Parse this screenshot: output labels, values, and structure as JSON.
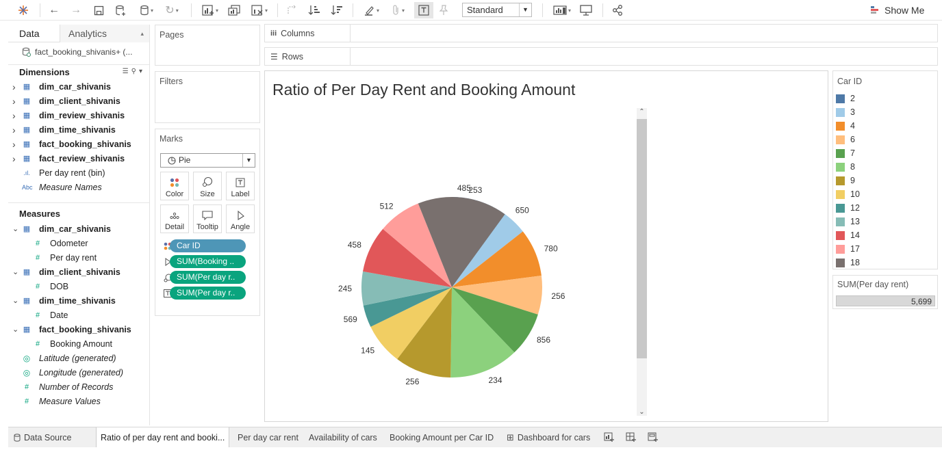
{
  "toolbar": {
    "fit": "Standard",
    "show_me": "Show Me"
  },
  "left_pane": {
    "tabs": [
      "Data",
      "Analytics"
    ],
    "datasource": "fact_booking_shivanis+ (...",
    "dimensions_title": "Dimensions",
    "dimensions": [
      {
        "label": "dim_car_shivanis",
        "kind": "table"
      },
      {
        "label": "dim_client_shivanis",
        "kind": "table"
      },
      {
        "label": "dim_review_shivanis",
        "kind": "table"
      },
      {
        "label": "dim_time_shivanis",
        "kind": "table"
      },
      {
        "label": "fact_booking_shivanis",
        "kind": "table"
      },
      {
        "label": "fact_review_shivanis",
        "kind": "table"
      },
      {
        "label": "Per day rent (bin)",
        "kind": "bin"
      },
      {
        "label": "Measure Names",
        "kind": "abc"
      }
    ],
    "measures_title": "Measures",
    "measures": [
      {
        "label": "dim_car_shivanis",
        "kind": "table-open"
      },
      {
        "label": "Odometer",
        "kind": "num"
      },
      {
        "label": "Per day rent",
        "kind": "num"
      },
      {
        "label": "dim_client_shivanis",
        "kind": "table-open"
      },
      {
        "label": "DOB",
        "kind": "num"
      },
      {
        "label": "dim_time_shivanis",
        "kind": "table-open"
      },
      {
        "label": "Date",
        "kind": "num"
      },
      {
        "label": "fact_booking_shivanis",
        "kind": "table-open"
      },
      {
        "label": "Booking Amount",
        "kind": "num"
      },
      {
        "label": "Latitude (generated)",
        "kind": "globe"
      },
      {
        "label": "Longitude (generated)",
        "kind": "globe"
      },
      {
        "label": "Number of Records",
        "kind": "numi"
      },
      {
        "label": "Measure Values",
        "kind": "numi"
      }
    ]
  },
  "cards": {
    "pages": "Pages",
    "filters": "Filters",
    "marks": "Marks",
    "mark_type": "Pie",
    "mark_buttons": [
      "Color",
      "Size",
      "Label",
      "Detail",
      "Tooltip",
      "Angle"
    ],
    "pills": [
      "Car ID",
      "SUM(Booking ..",
      "SUM(Per day r..",
      "SUM(Per day r.."
    ]
  },
  "shelves": {
    "columns": "Columns",
    "rows": "Rows"
  },
  "view": {
    "title": "Ratio of Per Day Rent and Booking Amount"
  },
  "legend": {
    "title": "Car ID",
    "items": [
      {
        "label": "2",
        "color": "#4e79a7"
      },
      {
        "label": "3",
        "color": "#a0cbe8"
      },
      {
        "label": "4",
        "color": "#f28e2b"
      },
      {
        "label": "6",
        "color": "#ffbe7d"
      },
      {
        "label": "7",
        "color": "#59a14f"
      },
      {
        "label": "8",
        "color": "#8cd17d"
      },
      {
        "label": "9",
        "color": "#b6992d"
      },
      {
        "label": "10",
        "color": "#f1ce63"
      },
      {
        "label": "12",
        "color": "#499894"
      },
      {
        "label": "13",
        "color": "#86bcb6"
      },
      {
        "label": "14",
        "color": "#e15759"
      },
      {
        "label": "17",
        "color": "#ff9d9a"
      },
      {
        "label": "18",
        "color": "#79706e"
      }
    ]
  },
  "size_legend": {
    "title": "SUM(Per day rent)",
    "value": "5,699"
  },
  "chart_data": {
    "type": "pie",
    "categories": [
      "2",
      "3",
      "4",
      "6",
      "7",
      "8",
      "9",
      "10",
      "12",
      "13",
      "14",
      "17",
      "18"
    ],
    "angle_field": "SUM(Booking Amount)",
    "label_field": "SUM(Per day rent)",
    "labels": [
      253,
      650,
      780,
      256,
      856,
      234,
      256,
      145,
      569,
      245,
      458,
      512,
      485
    ],
    "angle_fraction": [
      0.0754,
      0.0685,
      0.0855,
      0.0695,
      0.0794,
      0.1239,
      0.1012,
      0.0744,
      0.0397,
      0.0605,
      0.0838,
      0.0774,
      0.1608
    ]
  },
  "sheet_tabs": {
    "data_source": "Data Source",
    "sheets": [
      "Ratio of per day rent and booki...",
      "Per day car rent",
      "Availability of cars",
      "Booking Amount per Car ID",
      "Dashboard for cars"
    ]
  }
}
